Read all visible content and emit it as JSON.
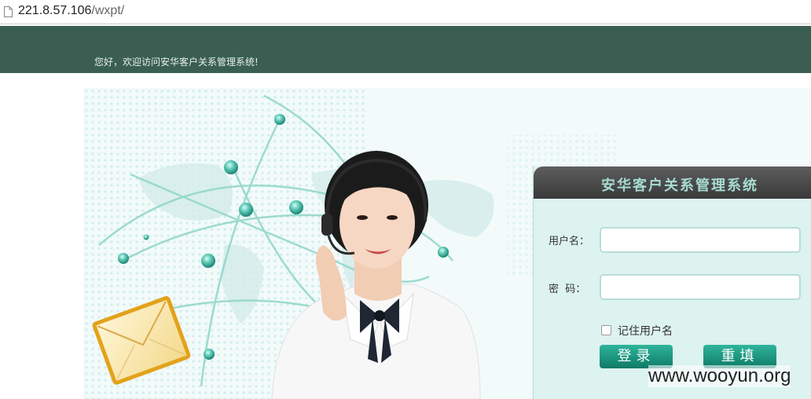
{
  "browser": {
    "url_host": "221.8.57.106",
    "url_path": "/wxpt/"
  },
  "header": {
    "welcome_text": "您好，欢迎访问安华客户关系管理系统!"
  },
  "login": {
    "title": "安华客户关系管理系统",
    "username_label": "用户名：",
    "password_label": "密  码：",
    "username_value": "",
    "password_value": "",
    "remember_label": "记住用户名",
    "remember_checked": false,
    "login_button": "登录",
    "reset_button": "重填"
  },
  "watermark": "www.wooyun.org",
  "colors": {
    "header_bg": "#3a5f52",
    "panel_bg": "#dcf3ef",
    "button_accent": "#1a9a82"
  }
}
